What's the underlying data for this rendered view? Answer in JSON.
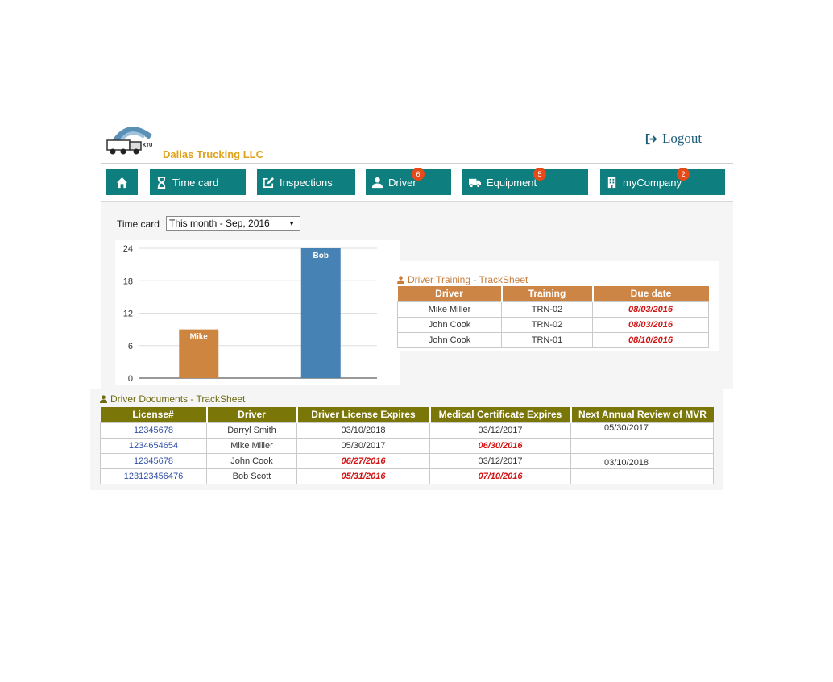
{
  "brand": {
    "company_name": "Dallas Trucking LLC",
    "logo_text": "KTU"
  },
  "header": {
    "logout_label": "Logout"
  },
  "nav": {
    "home_icon": "home-icon",
    "items": [
      {
        "label": "Time card",
        "icon": "hourglass-icon",
        "badge": null
      },
      {
        "label": "Inspections",
        "icon": "edit-icon",
        "badge": null
      },
      {
        "label": "Driver",
        "icon": "user-icon",
        "badge": "6"
      },
      {
        "label": "Equipment",
        "icon": "truck-icon",
        "badge": "5"
      },
      {
        "label": "myCompany",
        "icon": "building-icon",
        "badge": "2"
      }
    ],
    "color": "#0e7e7e",
    "badge_color": "#e64a19"
  },
  "timecard": {
    "label": "Time card",
    "selected_period": "This month - Sep, 2016"
  },
  "chart_data": {
    "type": "bar",
    "categories": [
      "Mike",
      "Bob"
    ],
    "values": [
      9,
      24
    ],
    "colors": [
      "#cd853f",
      "#4682b4"
    ],
    "data_labels": [
      "Mike",
      "Bob"
    ],
    "yticks": [
      "0",
      "6",
      "12",
      "18",
      "24"
    ],
    "ylim": [
      0,
      24
    ],
    "grid": true,
    "title": "",
    "xlabel": "",
    "ylabel": ""
  },
  "training": {
    "title": "Driver Training - TrackSheet",
    "columns": [
      "Driver",
      "Training",
      "Due date"
    ],
    "rows": [
      {
        "driver": "Mike Miller",
        "training": "TRN-02",
        "due": "08/03/2016"
      },
      {
        "driver": "John Cook",
        "training": "TRN-02",
        "due": "08/03/2016"
      },
      {
        "driver": "John Cook",
        "training": "TRN-01",
        "due": "08/10/2016"
      }
    ],
    "header_color": "#cc8545",
    "overdue_color": "#d21313"
  },
  "documents": {
    "title": "Driver Documents - TrackSheet",
    "columns": [
      "License#",
      "Driver",
      "Driver License Expires",
      "Medical Certificate Expires",
      "Next Annual Review of MVR"
    ],
    "rows": [
      {
        "license": "12345678",
        "driver": "Darryl Smith",
        "dl_expires": "03/10/2018",
        "med_expires": "03/12/2017",
        "mvr": "05/30/2017"
      },
      {
        "license": "1234654654",
        "driver": "Mike Miller",
        "dl_expires": "05/30/2017",
        "med_expires": "06/30/2016",
        "mvr": ""
      },
      {
        "license": "12345678",
        "driver": "John Cook",
        "dl_expires": "06/27/2016",
        "med_expires": "03/12/2017",
        "mvr": "03/10/2018"
      },
      {
        "license": "123123456476",
        "driver": "Bob Scott",
        "dl_expires": "05/31/2016",
        "med_expires": "07/10/2016",
        "mvr": ""
      }
    ],
    "header_color": "#7b7608"
  }
}
